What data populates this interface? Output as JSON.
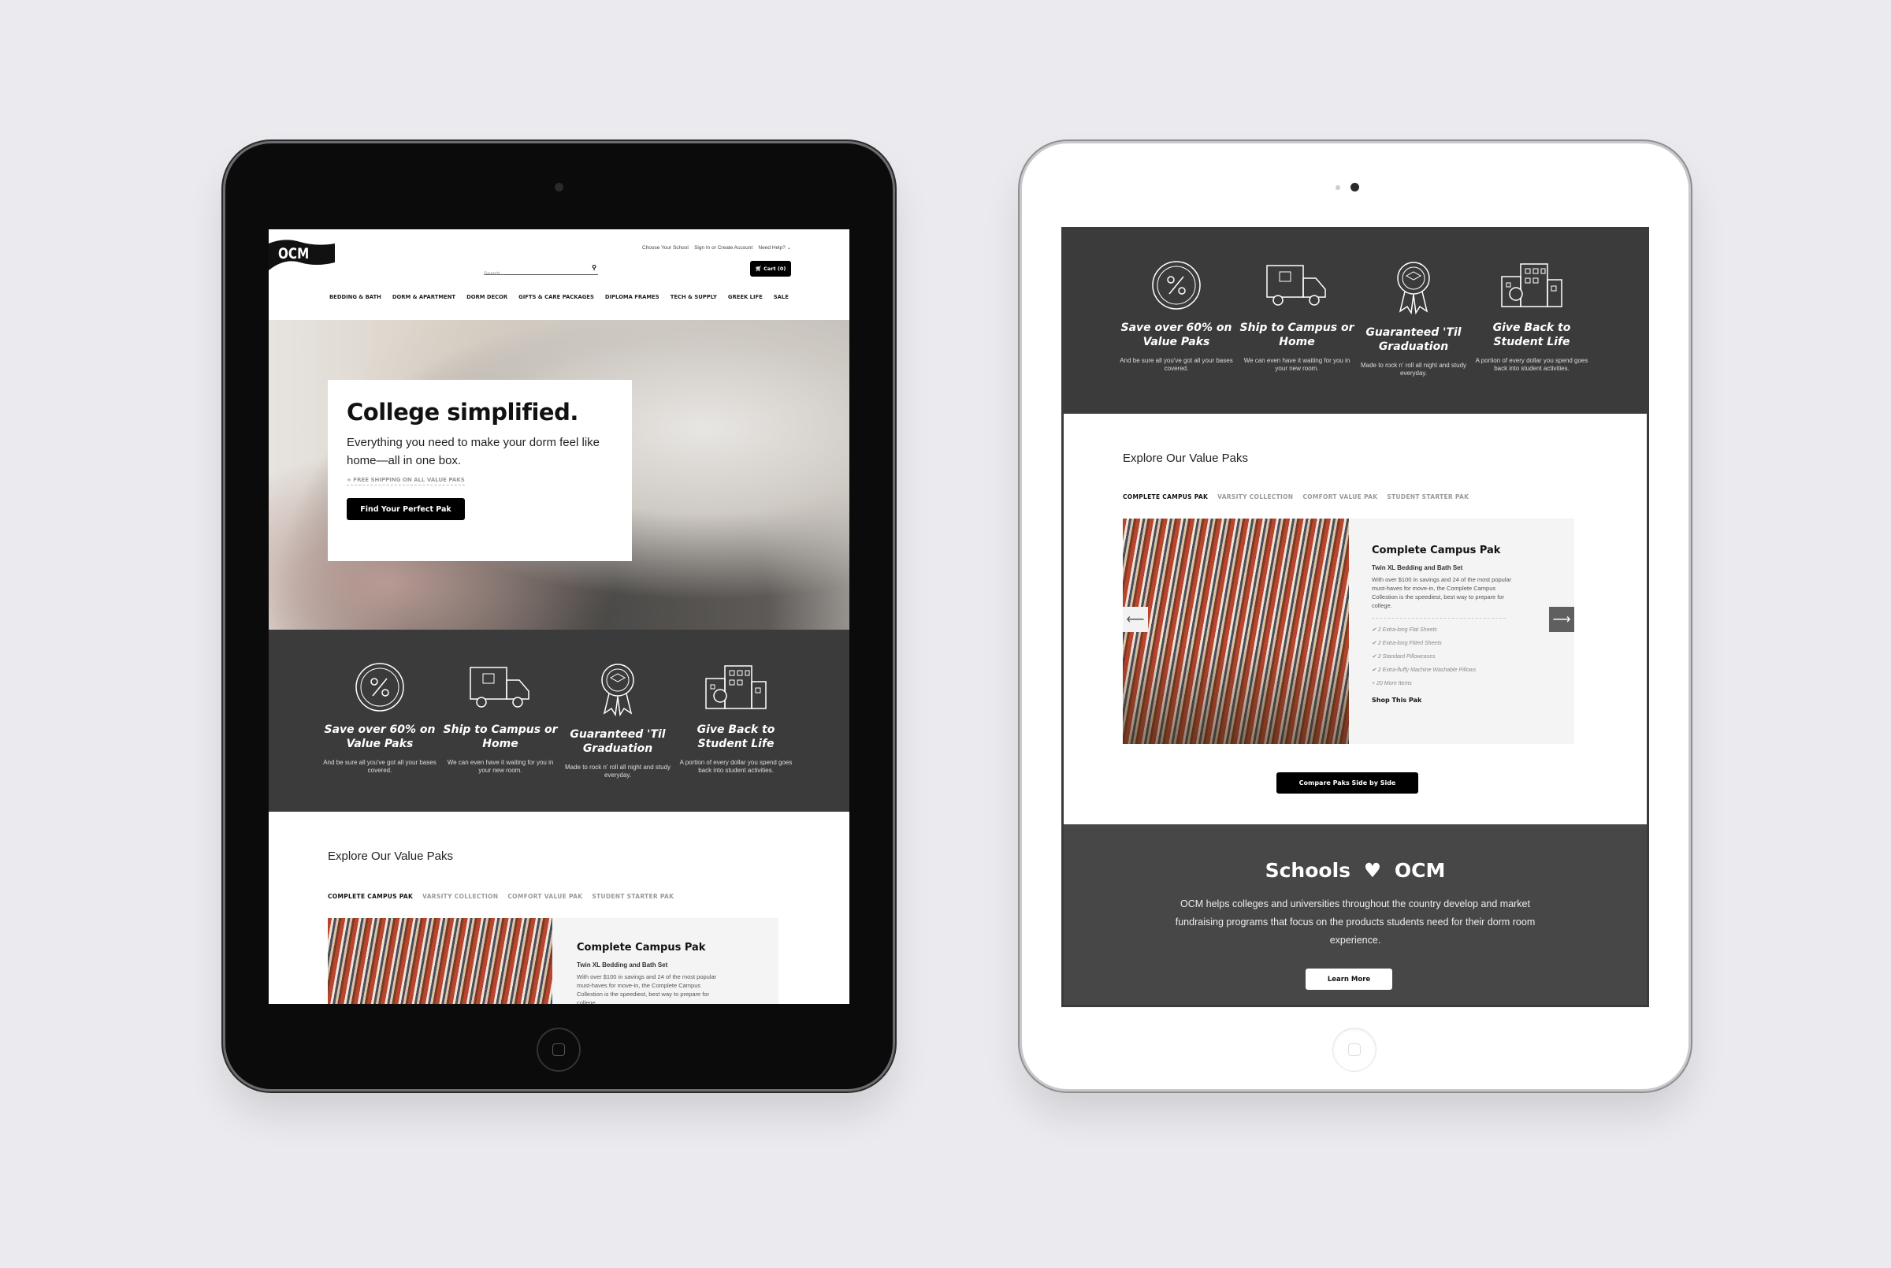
{
  "header": {
    "logo": "OCM",
    "top_links": {
      "choose_school": "Choose Your School",
      "sign_in": "Sign In",
      "or": "or",
      "create_account": "Create Account",
      "need_help": "Need Help?"
    },
    "search_placeholder": "Search...",
    "cart_label": "Cart (0)",
    "nav": [
      "BEDDING & BATH",
      "DORM & APARTMENT",
      "DORM DECOR",
      "GIFTS & CARE PACKAGES",
      "DIPLOMA FRAMES",
      "TECH & SUPPLY",
      "GREEK LIFE",
      "SALE"
    ]
  },
  "hero": {
    "title": "College simplified.",
    "subtitle": "Everything you need to make your dorm feel like home—all in one box.",
    "shipping_note": "+ FREE SHIPPING ON ALL VALUE PAKS",
    "cta": "Find Your Perfect Pak"
  },
  "features": [
    {
      "icon": "percent-icon",
      "title": "Save over 60% on Value Paks",
      "desc": "And be sure all you've got all your bases covered."
    },
    {
      "icon": "truck-icon",
      "title": "Ship to Campus or Home",
      "desc": "We can even have it waiting for you in your new room."
    },
    {
      "icon": "award-ribbon-icon",
      "title": "Guaranteed 'Til Graduation",
      "desc": "Made to rock n' roll all night and study everyday."
    },
    {
      "icon": "building-icon",
      "title": "Give Back to Student Life",
      "desc": "A portion of every dollar you spend goes back into student activities."
    }
  ],
  "explore": {
    "title": "Explore Our Value Paks",
    "tabs": [
      "COMPLETE CAMPUS PAK",
      "VARSITY COLLECTION",
      "COMFORT VALUE PAK",
      "STUDENT STARTER PAK"
    ],
    "active_tab": 0,
    "card": {
      "title": "Complete Campus Pak",
      "subtitle": "Twin XL Bedding and Bath Set",
      "description": "With over $100 in savings and 24 of the most popular must-haves for move-in, the Complete Campus Collestion is the speediest, best way to prepare for college.",
      "items": [
        "2 Extra-long Flat Sheets",
        "2 Extra-long Fitted Sheets",
        "2 Standard Pillowcases",
        "2 Extra-fluffy Machine Washable Pillows"
      ],
      "more": "+ 20 More Items",
      "shop_link": "Shop This Pak"
    },
    "compare_button": "Compare Paks Side by Side"
  },
  "schools": {
    "title_left": "Schools",
    "title_right": "OCM",
    "text": "OCM helps colleges and universities throughout the country develop and market fundraising programs that focus on the products students need for their dorm room experience.",
    "button": "Learn More"
  },
  "colors": {
    "background": "#ebeaef",
    "dark_band": "#3b3b3b",
    "accent": "#000000"
  }
}
